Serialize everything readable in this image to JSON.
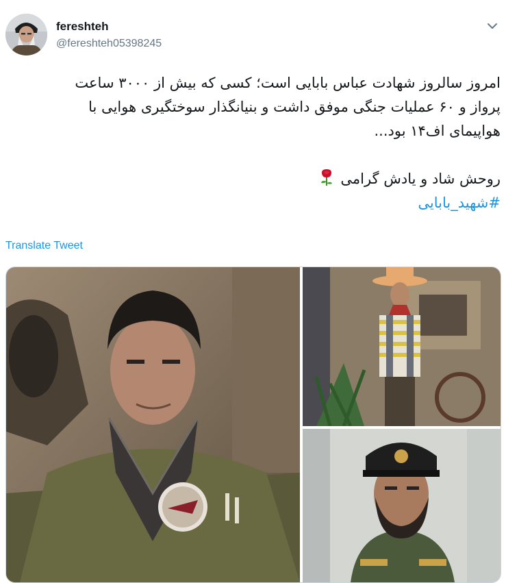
{
  "user": {
    "display_name": "fereshteh",
    "handle": "@fereshteh05398245"
  },
  "tweet": {
    "line1": "امروز سالروز شهادت عباس بابایی است؛ کسی که بیش از ۳۰۰۰ ساعت",
    "line2": "پرواز و ۶۰ عملیات جنگی موفق داشت و بنیانگذار سوختگیری هوایی با",
    "line3": "هواپیمای اف۱۴ بود...",
    "line4": "روحش شاد و یادش گرامی",
    "hashtag": "#شهید_بابایی",
    "emoji": "rose-icon"
  },
  "actions": {
    "translate_label": "Translate Tweet"
  },
  "icons": {
    "caret": "chevron-down-icon",
    "avatar": "avatar"
  },
  "colors": {
    "link": "#1b95e0",
    "text": "#14171a",
    "secondary": "#657786",
    "border": "#ccd6dd"
  }
}
